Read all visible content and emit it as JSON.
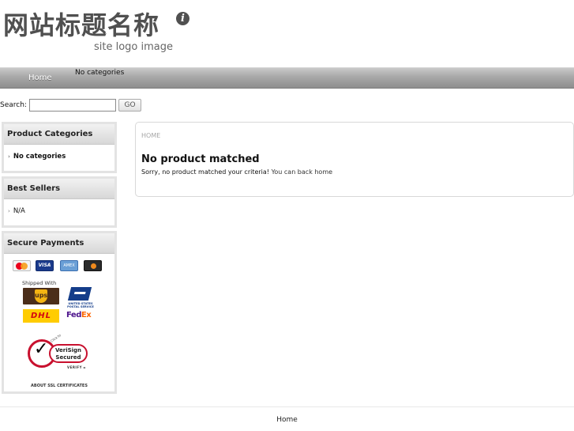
{
  "header": {
    "site_title": "网站标题名称",
    "info_glyph": "i",
    "site_subtitle": "site logo image"
  },
  "nav": {
    "home": "Home",
    "categories": "No categories"
  },
  "search": {
    "label": "Search:",
    "value": "",
    "button": "GO"
  },
  "sidebar": {
    "product_categories": {
      "title": "Product Categories",
      "items": [
        "No categories"
      ]
    },
    "best_sellers": {
      "title": "Best Sellers",
      "items": [
        "N/A"
      ]
    },
    "secure_payments": {
      "title": "Secure Payments",
      "cards": [
        "MasterCard",
        "VISA",
        "American Express",
        "Discover"
      ],
      "visa_text": "VISA",
      "amex_text": "AMEX",
      "shipped_with": "Shipped With",
      "carriers": {
        "ups": "ups",
        "usps": "UNITED STATES POSTAL SERVICE",
        "dhl": "DHL",
        "fedex_fe": "Fed",
        "fedex_ex": "Ex"
      },
      "verisign": {
        "name": "VeriSign",
        "secured": "Secured",
        "verify": "VERIFY ►",
        "click": "Click to"
      },
      "about_ssl": "ABOUT SSL CERTIFICATES"
    }
  },
  "main": {
    "breadcrumb": "HOME",
    "title": "No product matched",
    "message": "Sorry, no product matched your criteria!",
    "back_link": "You can back home"
  },
  "footer": {
    "home": "Home"
  },
  "colors": {
    "nav_bar": "#a8a8a8",
    "verisign_red": "#c8102e",
    "ups_brown": "#4b2e1a",
    "dhl_yellow": "#ffcc00",
    "fedex_purple": "#4d148c",
    "fedex_orange": "#ff6600"
  }
}
